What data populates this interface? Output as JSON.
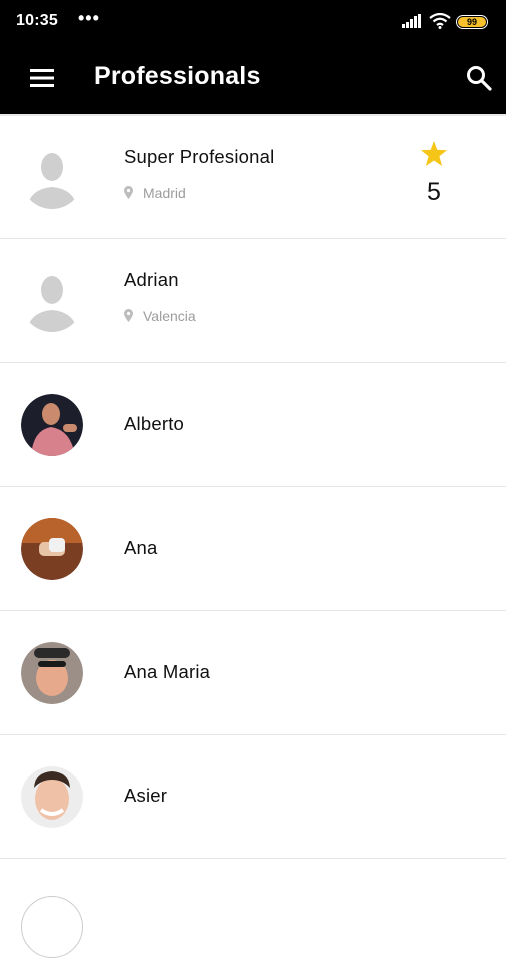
{
  "status_bar": {
    "time": "10:35",
    "dots": "•••",
    "battery": "99",
    "icons": [
      "signal-icon",
      "wifi-icon",
      "battery-icon"
    ]
  },
  "app_bar": {
    "title": "Professionals",
    "icons": [
      "menu-icon",
      "search-icon"
    ]
  },
  "colors": {
    "app_bar_bg": "#000000",
    "star": "#f5c518",
    "battery": "#f6c12c",
    "location_text": "#9c9c9c"
  },
  "professionals": [
    {
      "name": "Super Profesional",
      "location": "Madrid",
      "rating": "5",
      "avatar": "placeholder"
    },
    {
      "name": "Adrian",
      "location": "Valencia",
      "avatar": "placeholder"
    },
    {
      "name": "Alberto",
      "avatar": "photo"
    },
    {
      "name": "Ana",
      "avatar": "photo"
    },
    {
      "name": "Ana Maria",
      "avatar": "photo"
    },
    {
      "name": "Asier",
      "avatar": "photo"
    }
  ]
}
